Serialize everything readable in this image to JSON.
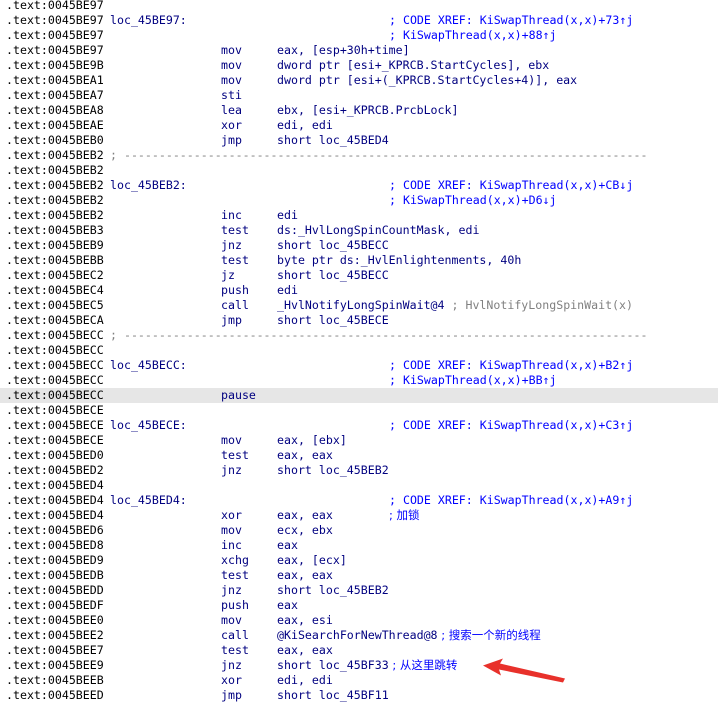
{
  "rows": [
    {
      "addr": ".text:0045BE97"
    },
    {
      "addr": ".text:0045BE97",
      "label": "loc_45BE97:",
      "comment": "; CODE XREF: KiSwapThread(x,x)+73↑j"
    },
    {
      "addr": ".text:0045BE97",
      "comment": "; KiSwapThread(x,x)+88↑j"
    },
    {
      "addr": ".text:0045BE97",
      "mnem": "mov",
      "ops": "eax, [esp+30h+time]"
    },
    {
      "addr": ".text:0045BE9B",
      "mnem": "mov",
      "ops": "dword ptr [esi+_KPRCB.StartCycles], ebx"
    },
    {
      "addr": ".text:0045BEA1",
      "mnem": "mov",
      "ops": "dword ptr [esi+(_KPRCB.StartCycles+4)], eax"
    },
    {
      "addr": ".text:0045BEA7",
      "mnem": "sti"
    },
    {
      "addr": ".text:0045BEA8",
      "mnem": "lea",
      "ops": "ebx, [esi+_KPRCB.PrcbLock]"
    },
    {
      "addr": ".text:0045BEAE",
      "mnem": "xor",
      "ops": "edi, edi"
    },
    {
      "addr": ".text:0045BEB0",
      "mnem": "jmp",
      "ops": "short loc_45BED4"
    },
    {
      "addr": ".text:0045BEB2",
      "sep": "; ---------------------------------------------------------------------------"
    },
    {
      "addr": ".text:0045BEB2"
    },
    {
      "addr": ".text:0045BEB2",
      "label": "loc_45BEB2:",
      "comment": "; CODE XREF: KiSwapThread(x,x)+CB↓j"
    },
    {
      "addr": ".text:0045BEB2",
      "comment": "; KiSwapThread(x,x)+D6↓j"
    },
    {
      "addr": ".text:0045BEB2",
      "mnem": "inc",
      "ops": "edi"
    },
    {
      "addr": ".text:0045BEB3",
      "mnem": "test",
      "ops": "ds:_HvlLongSpinCountMask, edi"
    },
    {
      "addr": ".text:0045BEB9",
      "mnem": "jnz",
      "ops": "short loc_45BECC"
    },
    {
      "addr": ".text:0045BEBB",
      "mnem": "test",
      "ops": "byte ptr ds:_HvlEnlightenments, 40h"
    },
    {
      "addr": ".text:0045BEC2",
      "mnem": "jz",
      "ops": "short loc_45BECC"
    },
    {
      "addr": ".text:0045BEC4",
      "mnem": "push",
      "ops": "edi"
    },
    {
      "addr": ".text:0045BEC5",
      "mnem": "call",
      "ops": "_HvlNotifyLongSpinWait@4",
      "inline_comment": " ; HvlNotifyLongSpinWait(x)",
      "inline_gray": true
    },
    {
      "addr": ".text:0045BECA",
      "mnem": "jmp",
      "ops": "short loc_45BECE"
    },
    {
      "addr": ".text:0045BECC",
      "sep": "; ---------------------------------------------------------------------------"
    },
    {
      "addr": ".text:0045BECC"
    },
    {
      "addr": ".text:0045BECC",
      "label": "loc_45BECC:",
      "comment": "; CODE XREF: KiSwapThread(x,x)+B2↑j"
    },
    {
      "addr": ".text:0045BECC",
      "comment": "; KiSwapThread(x,x)+BB↑j"
    },
    {
      "addr": ".text:0045BECC",
      "mnem": "pause",
      "selected": true
    },
    {
      "addr": ".text:0045BECE"
    },
    {
      "addr": ".text:0045BECE",
      "label": "loc_45BECE:",
      "comment": "; CODE XREF: KiSwapThread(x,x)+C3↑j"
    },
    {
      "addr": ".text:0045BECE",
      "mnem": "mov",
      "ops": "eax, [ebx]"
    },
    {
      "addr": ".text:0045BED0",
      "mnem": "test",
      "ops": "eax, eax"
    },
    {
      "addr": ".text:0045BED2",
      "mnem": "jnz",
      "ops": "short loc_45BEB2"
    },
    {
      "addr": ".text:0045BED4"
    },
    {
      "addr": ".text:0045BED4",
      "label": "loc_45BED4:",
      "comment": "; CODE XREF: KiSwapThread(x,x)+A9↑j"
    },
    {
      "addr": ".text:0045BED4",
      "mnem": "xor",
      "ops": "eax, eax",
      "comment": "; 加锁"
    },
    {
      "addr": ".text:0045BED6",
      "mnem": "mov",
      "ops": "ecx, ebx"
    },
    {
      "addr": ".text:0045BED8",
      "mnem": "inc",
      "ops": "eax"
    },
    {
      "addr": ".text:0045BED9",
      "mnem": "xchg",
      "ops": "eax, [ecx]"
    },
    {
      "addr": ".text:0045BEDB",
      "mnem": "test",
      "ops": "eax, eax"
    },
    {
      "addr": ".text:0045BEDD",
      "mnem": "jnz",
      "ops": "short loc_45BEB2"
    },
    {
      "addr": ".text:0045BEDF",
      "mnem": "push",
      "ops": "eax"
    },
    {
      "addr": ".text:0045BEE0",
      "mnem": "mov",
      "ops": "eax, esi"
    },
    {
      "addr": ".text:0045BEE2",
      "mnem": "call",
      "ops": "@KiSearchForNewThread@8",
      "inline_comment": " ; 搜索一个新的线程"
    },
    {
      "addr": ".text:0045BEE7",
      "mnem": "test",
      "ops": "eax, eax"
    },
    {
      "addr": ".text:0045BEE9",
      "mnem": "jnz",
      "ops": "short loc_45BF33",
      "inline_comment": " ; 从这里跳转"
    },
    {
      "addr": ".text:0045BEEB",
      "mnem": "xor",
      "ops": "edi, edi"
    },
    {
      "addr": ".text:0045BEED",
      "mnem": "jmp",
      "ops": "short loc_45BF11"
    }
  ],
  "annotation": {
    "arrow_color": "#e8312b",
    "arrow_target_row": 44
  }
}
